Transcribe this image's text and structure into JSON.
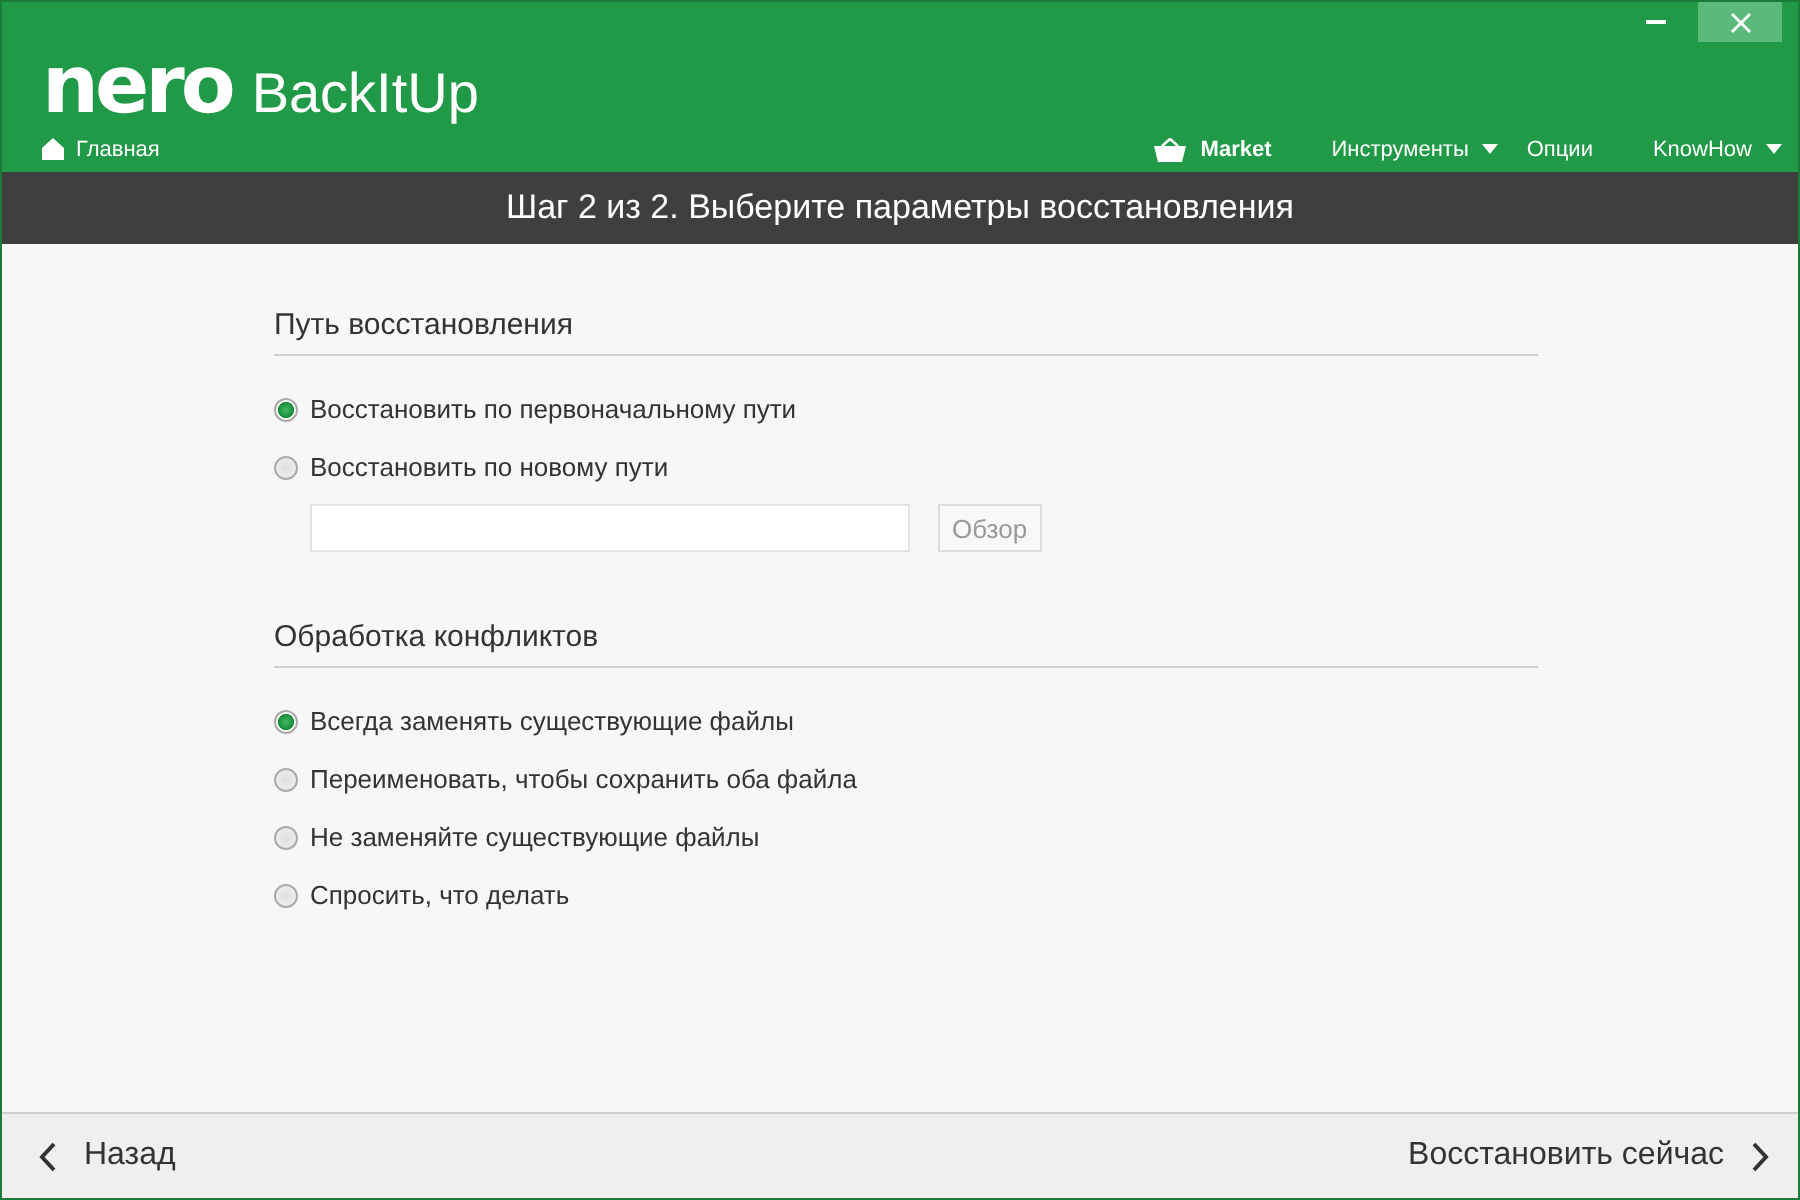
{
  "header": {
    "logo": "nero",
    "product": "BackItUp",
    "home": "Главная",
    "nav": [
      {
        "label": "Market",
        "kind": "market"
      },
      {
        "label": "Инструменты",
        "kind": "dropdown"
      },
      {
        "label": "Опции",
        "kind": "plain"
      },
      {
        "label": "KnowHow",
        "kind": "dropdown"
      }
    ]
  },
  "step_title": "Шаг 2 из 2. Выберите параметры восстановления",
  "sections": [
    {
      "title": "Путь восстановления",
      "options": [
        {
          "label": "Восстановить по первоначальному пути",
          "selected": true
        },
        {
          "label": "Восстановить по новому пути",
          "selected": false
        }
      ],
      "path": {
        "browse": "Обзор",
        "disabled": true
      }
    },
    {
      "title": "Обработка конфликтов",
      "options": [
        {
          "label": "Всегда заменять существующие файлы",
          "selected": true
        },
        {
          "label": "Переименовать, чтобы сохранить оба файла",
          "selected": false
        },
        {
          "label": "Не заменяйте существующие файлы",
          "selected": false
        },
        {
          "label": "Спросить, что делать",
          "selected": false
        }
      ]
    }
  ],
  "footer": {
    "back": "Назад",
    "next": "Восстановить сейчас"
  }
}
